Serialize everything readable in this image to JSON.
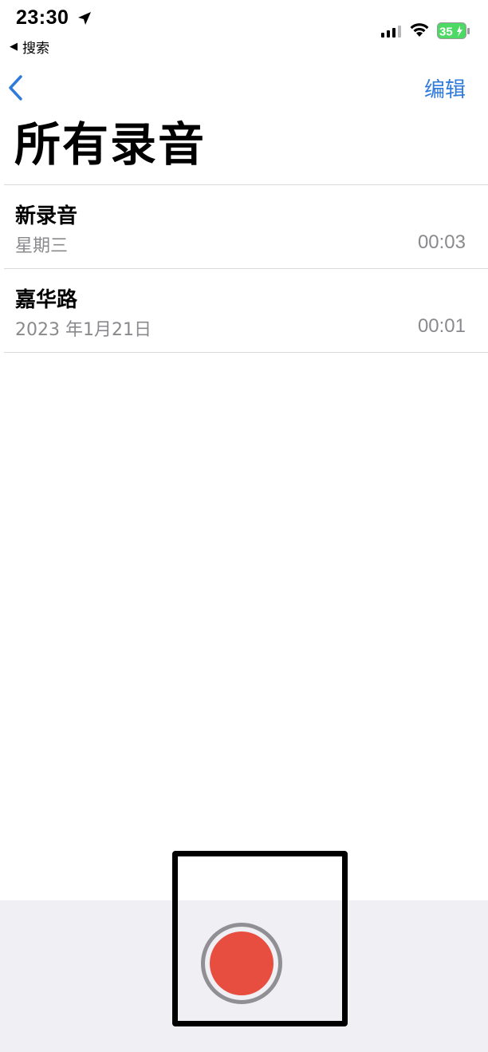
{
  "status_bar": {
    "time": "23:30",
    "back_app_label": "搜索",
    "back_triangle": "◀",
    "battery_level": "35",
    "battery_color": "#4cd964"
  },
  "nav": {
    "back_icon": "chevron-left-icon",
    "edit_label": "编辑",
    "accent_color": "#2f7bdb"
  },
  "title": "所有录音",
  "recordings": [
    {
      "name": "新录音",
      "date": "星期三",
      "duration": "00:03"
    },
    {
      "name": "嘉华路",
      "date": "2023 年1月21日",
      "duration": "00:01"
    }
  ],
  "record_button": {
    "icon": "record-icon",
    "color": "#e84e3f"
  }
}
